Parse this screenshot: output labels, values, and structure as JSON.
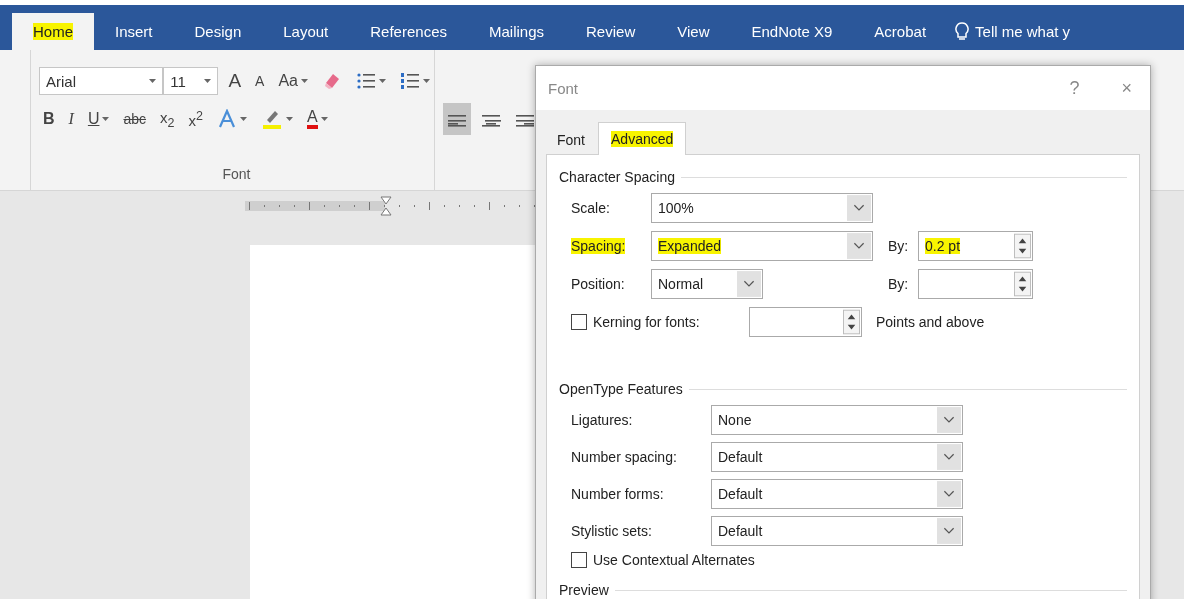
{
  "ribbon_tabs": [
    {
      "label": "Home",
      "selected": true,
      "highlighted": true
    },
    {
      "label": "Insert",
      "selected": false,
      "highlighted": false
    },
    {
      "label": "Design",
      "selected": false,
      "highlighted": false
    },
    {
      "label": "Layout",
      "selected": false,
      "highlighted": false
    },
    {
      "label": "References",
      "selected": false,
      "highlighted": false
    },
    {
      "label": "Mailings",
      "selected": false,
      "highlighted": false
    },
    {
      "label": "Review",
      "selected": false,
      "highlighted": false
    },
    {
      "label": "View",
      "selected": false,
      "highlighted": false
    },
    {
      "label": "EndNote X9",
      "selected": false,
      "highlighted": false
    },
    {
      "label": "Acrobat",
      "selected": false,
      "highlighted": false
    }
  ],
  "tell_me": "Tell me what y",
  "ribbon": {
    "font_name": "Arial",
    "font_size": "11",
    "group_label": "Font",
    "row1": [
      {
        "kind": "grow",
        "text": "A",
        "dropdown": false,
        "selected": false
      },
      {
        "kind": "shrink",
        "text": "A",
        "dropdown": false,
        "selected": false
      },
      {
        "kind": "glyph",
        "text": "Aa",
        "dropdown": true,
        "selected": false
      },
      {
        "kind": "eraser",
        "dropdown": false,
        "selected": false
      },
      {
        "kind": "bullets",
        "dropdown": true,
        "selected": false
      },
      {
        "kind": "numbering",
        "dropdown": true,
        "selected": false
      }
    ],
    "row2": [
      {
        "kind": "bold",
        "text": "B",
        "dropdown": false,
        "selected": false
      },
      {
        "kind": "italic",
        "text": "I",
        "dropdown": false,
        "selected": false
      },
      {
        "kind": "underline",
        "text": "U",
        "dropdown": true,
        "selected": false
      },
      {
        "kind": "strike",
        "text": "abc",
        "dropdown": false,
        "selected": false
      },
      {
        "kind": "sub",
        "text": "x$_{2}$",
        "dropdown": false,
        "selected": false
      },
      {
        "kind": "sup",
        "text": "x$^{2}$",
        "dropdown": false,
        "selected": false
      },
      {
        "kind": "effects",
        "dropdown": true,
        "selected": false
      },
      {
        "kind": "highlighter",
        "dropdown": true,
        "selected": false,
        "color": "#f5f000"
      },
      {
        "kind": "fontcolor",
        "text": "A",
        "dropdown": true,
        "selected": false,
        "color": "#e01010"
      },
      {
        "kind": "align-left",
        "dropdown": false,
        "selected": true
      },
      {
        "kind": "align-center",
        "dropdown": false,
        "selected": false
      },
      {
        "kind": "align-right",
        "dropdown": false,
        "selected": false
      }
    ]
  },
  "dialog": {
    "title": "Font",
    "help": "?",
    "close": "×",
    "tabs": [
      {
        "label": "Font",
        "selected": false,
        "highlighted": false
      },
      {
        "label": "Advanced",
        "selected": true,
        "highlighted": true
      }
    ],
    "character_spacing": {
      "title": "Character Spacing",
      "scale": {
        "label": "Scale:",
        "value": "100%"
      },
      "spacing": {
        "label": "Spacing:",
        "label_highlighted": true,
        "value": "Expanded",
        "value_highlighted": true,
        "by_label": "By:",
        "by_value": "0.2 pt",
        "by_highlighted": true
      },
      "position": {
        "label": "Position:",
        "value": "Normal",
        "by_label": "By:"
      },
      "kerning": {
        "label": "Kerning for fonts:",
        "checked": false,
        "suffix": "Points and above"
      }
    },
    "opentype": {
      "title": "OpenType Features",
      "rows": [
        {
          "label": "Ligatures:",
          "value": "None"
        },
        {
          "label": "Number spacing:",
          "value": "Default"
        },
        {
          "label": "Number forms:",
          "value": "Default"
        },
        {
          "label": "Stylistic sets:",
          "value": "Default"
        }
      ],
      "contextual": {
        "label": "Use Contextual Alternates",
        "checked": false
      }
    },
    "preview_title": "Preview"
  }
}
